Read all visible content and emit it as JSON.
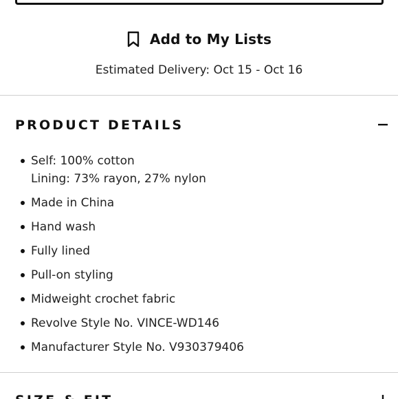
{
  "add_to_lists": {
    "label": "Add to My Lists",
    "icon": "bookmark-icon"
  },
  "delivery": {
    "text": "Estimated Delivery: Oct 15 - Oct 16"
  },
  "product_details": {
    "title": "PRODUCT DETAILS",
    "toggle_icon": "minus-icon",
    "items": [
      [
        "Self: 100% cotton",
        "Lining: 73% rayon, 27% nylon"
      ],
      [
        "Made in China"
      ],
      [
        "Hand wash"
      ],
      [
        "Fully lined"
      ],
      [
        "Pull-on styling"
      ],
      [
        "Midweight crochet fabric"
      ],
      [
        "Revolve Style No. VINCE-WD146"
      ],
      [
        "Manufacturer Style No. V930379406"
      ]
    ]
  },
  "size_fit": {
    "title": "SIZE & FIT",
    "toggle_icon": "plus-icon"
  }
}
